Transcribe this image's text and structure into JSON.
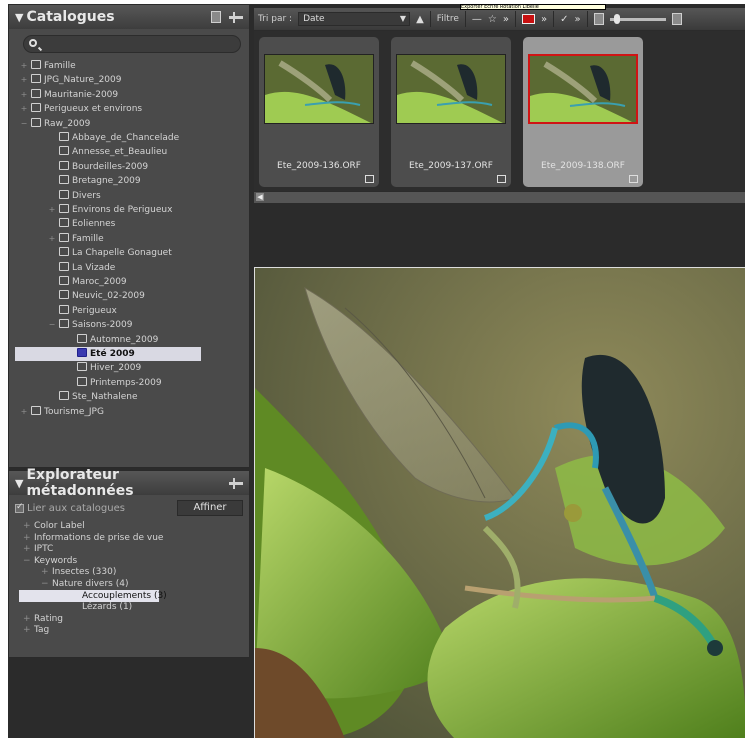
{
  "catalogues": {
    "title": "Catalogues",
    "search_placeholder": "",
    "tree": [
      {
        "label": "Famille",
        "level": 0,
        "expander": "+",
        "icon": "catalog-icon"
      },
      {
        "label": "JPG_Nature_2009",
        "level": 0,
        "expander": "+",
        "icon": "catalog-icon"
      },
      {
        "label": "Mauritanie-2009",
        "level": 0,
        "expander": "+",
        "icon": "catalog-icon"
      },
      {
        "label": "Perigueux et environs",
        "level": 0,
        "expander": "+",
        "icon": "catalog-icon"
      },
      {
        "label": "Raw_2009",
        "level": 0,
        "expander": "−",
        "icon": "catalog-icon"
      },
      {
        "label": "Abbaye_de_Chancelade",
        "level": 1,
        "expander": "",
        "icon": "folder-icon"
      },
      {
        "label": "Annesse_et_Beaulieu",
        "level": 1,
        "expander": "",
        "icon": "folder-icon"
      },
      {
        "label": "Bourdeilles-2009",
        "level": 1,
        "expander": "",
        "icon": "folder-icon"
      },
      {
        "label": "Bretagne_2009",
        "level": 1,
        "expander": "",
        "icon": "folder-icon"
      },
      {
        "label": "Divers",
        "level": 1,
        "expander": "",
        "icon": "folder-icon"
      },
      {
        "label": "Environs de Perigueux",
        "level": 1,
        "expander": "+",
        "icon": "folder-icon"
      },
      {
        "label": "Eoliennes",
        "level": 1,
        "expander": "",
        "icon": "folder-icon"
      },
      {
        "label": "Famille",
        "level": 1,
        "expander": "+",
        "icon": "folder-icon"
      },
      {
        "label": "La Chapelle Gonaguet",
        "level": 1,
        "expander": "",
        "icon": "folder-icon"
      },
      {
        "label": "La Vizade",
        "level": 1,
        "expander": "",
        "icon": "folder-icon"
      },
      {
        "label": "Maroc_2009",
        "level": 1,
        "expander": "",
        "icon": "folder-icon"
      },
      {
        "label": "Neuvic_02-2009",
        "level": 1,
        "expander": "",
        "icon": "folder-icon"
      },
      {
        "label": "Perigueux",
        "level": 1,
        "expander": "",
        "icon": "folder-icon"
      },
      {
        "label": "Saisons-2009",
        "level": 1,
        "expander": "−",
        "icon": "folder-icon"
      },
      {
        "label": "Automne_2009",
        "level": 2,
        "expander": "",
        "icon": "folder-icon"
      },
      {
        "label": "Eté 2009",
        "level": 2,
        "expander": "",
        "icon": "folder-icon",
        "selected": true
      },
      {
        "label": "Hiver_2009",
        "level": 2,
        "expander": "",
        "icon": "folder-icon"
      },
      {
        "label": "Printemps-2009",
        "level": 2,
        "expander": "",
        "icon": "folder-icon"
      },
      {
        "label": "Ste_Nathalene",
        "level": 1,
        "expander": "",
        "icon": "folder-icon"
      },
      {
        "label": "Tourisme_JPG",
        "level": 0,
        "expander": "+",
        "icon": "catalog-icon"
      }
    ]
  },
  "metadata": {
    "title": "Explorateur métadonnées",
    "link_label": "Lier aux catalogues",
    "refine_label": "Affiner",
    "tree": [
      {
        "label": "Color Label",
        "level": 0,
        "expander": "+"
      },
      {
        "label": "Informations de prise de vue",
        "level": 0,
        "expander": "+"
      },
      {
        "label": "IPTC",
        "level": 0,
        "expander": "+"
      },
      {
        "label": "Keywords",
        "level": 0,
        "expander": "−"
      },
      {
        "label": "Insectes (330)",
        "level": 1,
        "expander": "+"
      },
      {
        "label": "Nature divers (4)",
        "level": 1,
        "expander": "−"
      },
      {
        "label": "Accouplements (3)",
        "level": 2,
        "expander": "",
        "selected": true
      },
      {
        "label": "Lézards (1)",
        "level": 2,
        "expander": ""
      },
      {
        "label": "Rating",
        "level": 0,
        "expander": "+"
      },
      {
        "label": "Tag",
        "level": 0,
        "expander": "+"
      }
    ]
  },
  "toolbar": {
    "sort_label": "Tri par :",
    "sort_value": "Date",
    "filter_label": "Filtre",
    "tooltip": "Exporter Ecrire Rotation Libellé",
    "color_label": "#c81010"
  },
  "thumbnails": [
    {
      "name": "Ete_2009-136.ORF",
      "selected": false
    },
    {
      "name": "Ete_2009-137.ORF",
      "selected": false
    },
    {
      "name": "Ete_2009-138.ORF",
      "selected": true
    }
  ]
}
